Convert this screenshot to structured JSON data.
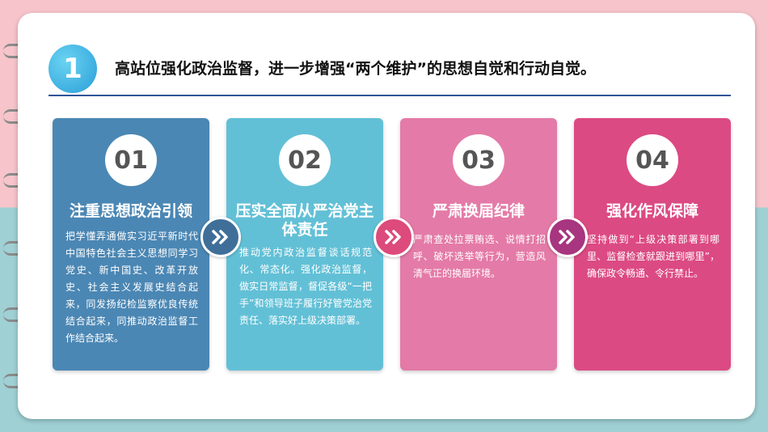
{
  "header": {
    "number": "1",
    "title": "高站位强化政治监督，进一步增强“两个维护”的思想自觉和行动自觉。"
  },
  "cards": [
    {
      "number": "01",
      "title": "注重思想政治引领",
      "body": "把学懂弄通做实习近平新时代中国特色社会主义思想同学习党史、新中国史、改革开放史、社会主义发展史结合起来，同发扬纪检监察优良传统结合起来，同推动政治监督工作结合起来。",
      "color": "#4b87b4"
    },
    {
      "number": "02",
      "title": "压实全面从严治党主体责任",
      "body": "推动党内政治监督谈话规范化、常态化。强化政治监督，做实日常监督，督促各级“一把手”和领导班子履行好管党治党责任、落实好上级决策部署。",
      "color": "#62c0d6"
    },
    {
      "number": "03",
      "title": "严肃换届纪律",
      "body": "严肃查处拉票贿选、说情打招呼、破坏选举等行为，营造风清气正的换届环境。",
      "color": "#e47aa7"
    },
    {
      "number": "04",
      "title": "强化作风保障",
      "body": "坚持做到“上级决策部署到哪里、监督检查就跟进到哪里”，确保政令畅通、令行禁止。",
      "color": "#dc4a83"
    }
  ],
  "arrows": [
    {
      "icon": "double-chevron-right-icon",
      "color": "#3f6f99"
    },
    {
      "icon": "double-chevron-right-icon",
      "color": "#dd4a7c"
    },
    {
      "icon": "double-chevron-right-icon",
      "color": "#a8357f"
    }
  ]
}
